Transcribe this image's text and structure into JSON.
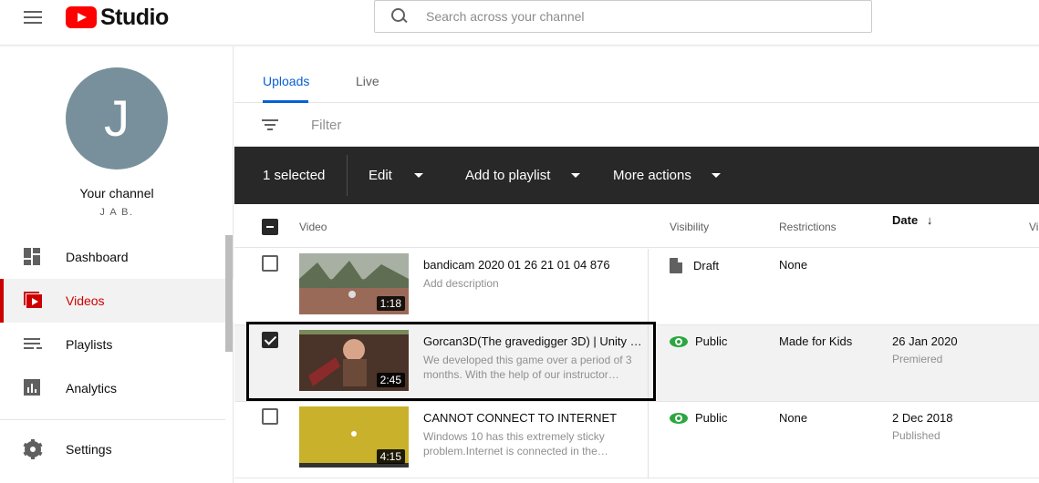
{
  "header": {
    "logo_text": "Studio",
    "search_placeholder": "Search across your channel"
  },
  "sidebar": {
    "avatar_letter": "J",
    "channel_title": "Your channel",
    "channel_subtitle": "J A B.",
    "items": [
      {
        "label": "Dashboard",
        "icon": "dashboard-icon"
      },
      {
        "label": "Videos",
        "icon": "videos-icon",
        "active": true
      },
      {
        "label": "Playlists",
        "icon": "playlists-icon"
      },
      {
        "label": "Analytics",
        "icon": "analytics-icon"
      },
      {
        "label": "Settings",
        "icon": "settings-icon"
      }
    ]
  },
  "tabs": [
    {
      "label": "Uploads",
      "active": true
    },
    {
      "label": "Live",
      "active": false
    }
  ],
  "filter": {
    "placeholder": "Filter"
  },
  "actionbar": {
    "selected_label": "1 selected",
    "edit_label": "Edit",
    "playlist_label": "Add to playlist",
    "more_label": "More actions"
  },
  "columns": {
    "video": "Video",
    "visibility": "Visibility",
    "restrictions": "Restrictions",
    "date": "Date",
    "views_partial": "Vi"
  },
  "rows": [
    {
      "title": "bandicam 2020 01 26 21 01 04 876",
      "description": "Add description",
      "duration": "1:18",
      "visibility": "Draft",
      "restrictions": "None",
      "date": "",
      "date_sub": "",
      "checked": false
    },
    {
      "title": "Gorcan3D(The gravedigger 3D) | Unity …",
      "description": "We developed this game over a period of 3 months. With the help of our instructor…",
      "duration": "2:45",
      "visibility": "Public",
      "restrictions": "Made for Kids",
      "date": "26 Jan 2020",
      "date_sub": "Premiered",
      "checked": true
    },
    {
      "title": "CANNOT CONNECT TO INTERNET",
      "description": "Windows 10 has this extremely sticky problem.Internet is connected in the…",
      "duration": "4:15",
      "visibility": "Public",
      "restrictions": "None",
      "date": "2 Dec 2018",
      "date_sub": "Published",
      "checked": false
    }
  ],
  "colors": {
    "brand_red": "#ff0000",
    "active_red": "#cc0000",
    "tab_blue": "#065fd4",
    "public_green": "#2ba640",
    "actionbar_bg": "#282828"
  }
}
